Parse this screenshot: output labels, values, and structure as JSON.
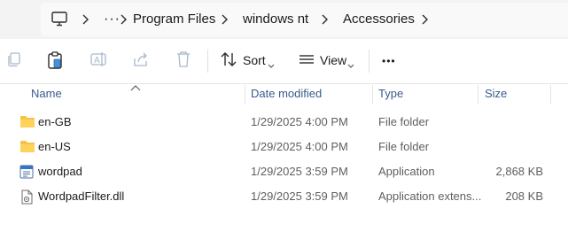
{
  "breadcrumb": {
    "more_label": "···",
    "items": [
      {
        "label": "Program Files"
      },
      {
        "label": "windows nt"
      },
      {
        "label": "Accessories"
      }
    ]
  },
  "toolbar": {
    "sort_label": "Sort",
    "view_label": "View",
    "more_label": "•••"
  },
  "columns": {
    "name": "Name",
    "date": "Date modified",
    "type": "Type",
    "size": "Size"
  },
  "files": [
    {
      "name": "en-GB",
      "date": "1/29/2025 4:00 PM",
      "type": "File folder",
      "size": "",
      "icon": "folder-icon"
    },
    {
      "name": "en-US",
      "date": "1/29/2025 4:00 PM",
      "type": "File folder",
      "size": "",
      "icon": "folder-icon"
    },
    {
      "name": "wordpad",
      "date": "1/29/2025 3:59 PM",
      "type": "Application",
      "size": "2,868 KB",
      "icon": "wordpad-app-icon"
    },
    {
      "name": "WordpadFilter.dll",
      "date": "1/29/2025 3:59 PM",
      "type": "Application extens...",
      "size": "208 KB",
      "icon": "dll-file-icon"
    }
  ],
  "colors": {
    "folder": "#f4c542",
    "header_text": "#3a5a8c",
    "disabled_icon": "#a9b8cc"
  }
}
